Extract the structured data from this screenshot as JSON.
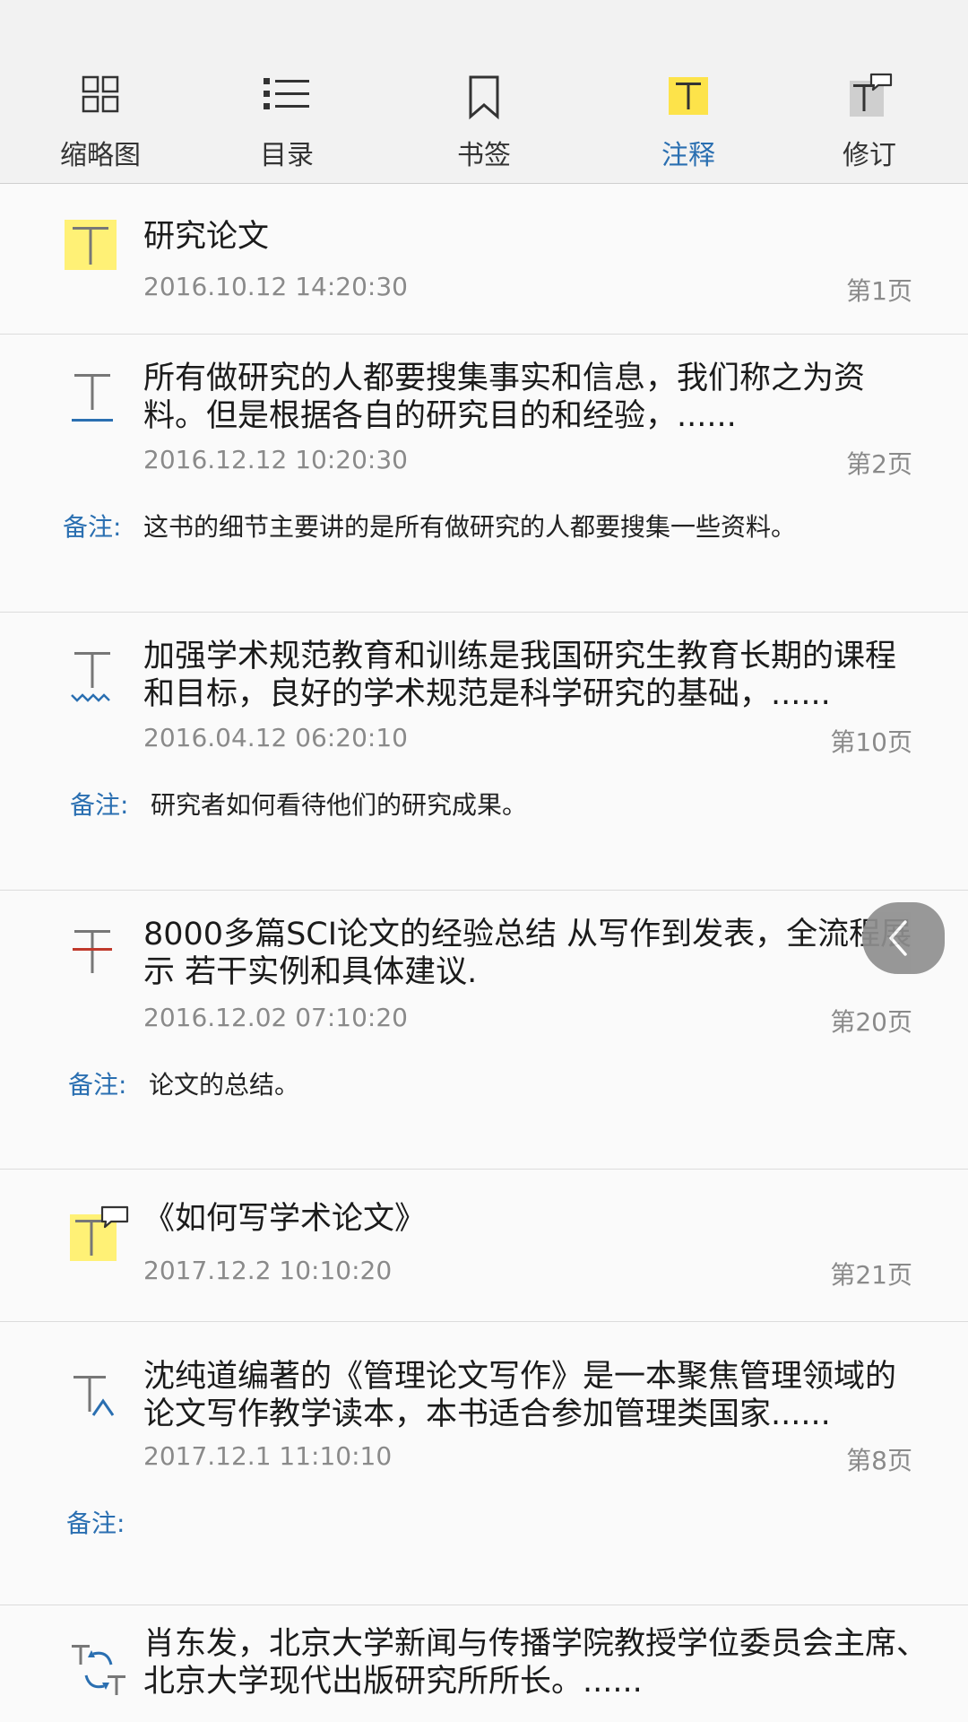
{
  "tabs": [
    {
      "label": "缩略图",
      "icon": "thumbnail-grid-icon"
    },
    {
      "label": "目录",
      "icon": "list-icon"
    },
    {
      "label": "书签",
      "icon": "bookmark-icon"
    },
    {
      "label": "注释",
      "icon": "highlight-text-icon",
      "active": true
    },
    {
      "label": "修订",
      "icon": "revision-icon"
    }
  ],
  "annotations": [
    {
      "type": "highlight",
      "text": "研究论文",
      "date": "2016.10.12  14:20:30",
      "page": "第1页"
    },
    {
      "type": "underline",
      "text": "所有做研究的人都要搜集事实和信息，我们称之为资料。但是根据各自的研究目的和经验，......",
      "date": "2016.12.12  10:20:30",
      "page": "第2页",
      "note_label": "备注:",
      "note": "这书的细节主要讲的是所有做研究的人都要搜集一些资料。"
    },
    {
      "type": "squiggly",
      "text": "加强学术规范教育和训练是我国研究生教育长期的课程和目标，良好的学术规范是科学研究的基础，......",
      "date": "2016.04.12  06:20:10",
      "page": "第10页",
      "note_label": "备注:",
      "note": "研究者如何看待他们的研究成果。"
    },
    {
      "type": "strikethrough",
      "text": "8000多篇SCI论文的经验总结 从写作到发表，全流程展示 若干实例和具体建议.",
      "date": "2016.12.02 07:10:20",
      "page": "第20页",
      "note_label": "备注:",
      "note": "论文的总结。"
    },
    {
      "type": "highlight-comment",
      "text": "《如何写学术论文》",
      "date": "2017.12.2  10:10:20",
      "page": "第21页"
    },
    {
      "type": "insert",
      "text": "沈纯道编著的《管理论文写作》是一本聚焦管理领域的论文写作教学读本，本书适合参加管理类国家......",
      "date": "2017.12.1  11:10:10",
      "page": "第8页",
      "note_label": "备注:",
      "note": ""
    },
    {
      "type": "replace",
      "text": "肖东发，北京大学新闻与传播学院教授学位委员会主席、北京大学现代出版研究所所长。......"
    }
  ],
  "colors": {
    "accent": "#2a6fb1",
    "highlight": "#fff176",
    "strike": "#c0392b"
  },
  "collapse_icon": "chevron-left-icon"
}
